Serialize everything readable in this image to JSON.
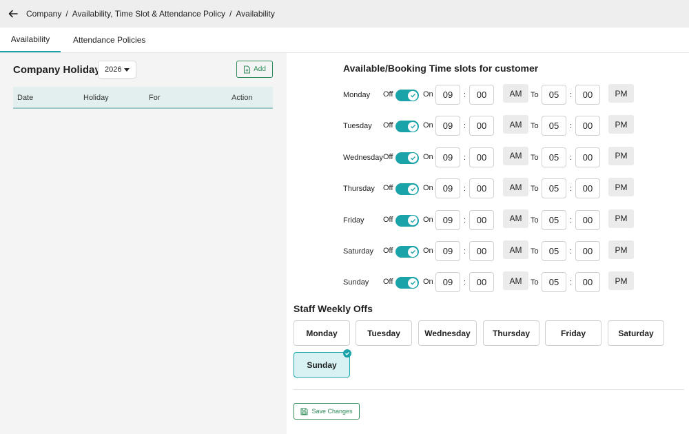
{
  "breadcrumb": [
    "Company",
    "Availability, Time Slot & Attendance Policy",
    "Availability"
  ],
  "breadcrumb_sep": "/",
  "tabs": [
    "Availability",
    "Attendance Policies"
  ],
  "holidays": {
    "title": "Company Holidays",
    "year": "2026",
    "add_label": "Add",
    "columns": [
      "Date",
      "Holiday",
      "For",
      "Action"
    ]
  },
  "slots": {
    "title": "Available/Booking Time slots for customer",
    "off_label": "Off",
    "on_label": "On",
    "to_label": "To",
    "colon": ":",
    "days": [
      {
        "day": "Monday",
        "start_h": "09",
        "start_m": "00",
        "start_ampm": "AM",
        "end_h": "05",
        "end_m": "00",
        "end_ampm": "PM",
        "enabled": true
      },
      {
        "day": "Tuesday",
        "start_h": "09",
        "start_m": "00",
        "start_ampm": "AM",
        "end_h": "05",
        "end_m": "00",
        "end_ampm": "PM",
        "enabled": true
      },
      {
        "day": "Wednesday",
        "start_h": "09",
        "start_m": "00",
        "start_ampm": "AM",
        "end_h": "05",
        "end_m": "00",
        "end_ampm": "PM",
        "enabled": true
      },
      {
        "day": "Thursday",
        "start_h": "09",
        "start_m": "00",
        "start_ampm": "AM",
        "end_h": "05",
        "end_m": "00",
        "end_ampm": "PM",
        "enabled": true
      },
      {
        "day": "Friday",
        "start_h": "09",
        "start_m": "00",
        "start_ampm": "AM",
        "end_h": "05",
        "end_m": "00",
        "end_ampm": "PM",
        "enabled": true
      },
      {
        "day": "Saturday",
        "start_h": "09",
        "start_m": "00",
        "start_ampm": "AM",
        "end_h": "05",
        "end_m": "00",
        "end_ampm": "PM",
        "enabled": true
      },
      {
        "day": "Sunday",
        "start_h": "09",
        "start_m": "00",
        "start_ampm": "AM",
        "end_h": "05",
        "end_m": "00",
        "end_ampm": "PM",
        "enabled": true
      }
    ]
  },
  "weekly_offs": {
    "title": "Staff Weekly Offs",
    "days": [
      {
        "label": "Monday",
        "selected": false
      },
      {
        "label": "Tuesday",
        "selected": false
      },
      {
        "label": "Wednesday",
        "selected": false
      },
      {
        "label": "Thursday",
        "selected": false
      },
      {
        "label": "Friday",
        "selected": false
      },
      {
        "label": "Saturday",
        "selected": false
      },
      {
        "label": "Sunday",
        "selected": true
      }
    ]
  },
  "save_label": "Save Changes",
  "colors": {
    "accent": "#1aa3a8",
    "green": "#2e8b57",
    "panel": "#f4f4f4"
  }
}
